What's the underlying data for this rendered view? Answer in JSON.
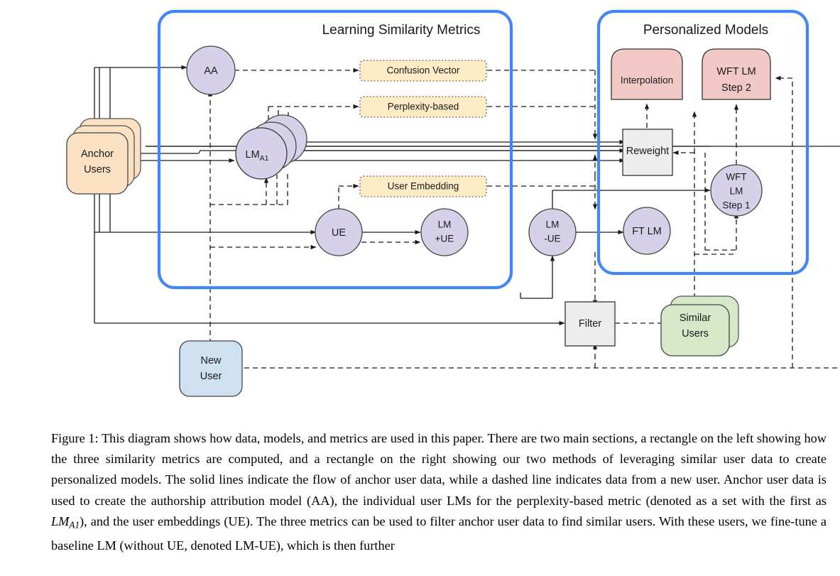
{
  "figure": {
    "sections": [
      {
        "id": "learning-similarity-metrics",
        "title": "Learning Similarity Metrics"
      },
      {
        "id": "personalized-models",
        "title": "Personalized Models"
      }
    ],
    "nodes": {
      "anchor_users": {
        "label_line1": "Anchor",
        "label_line2": "Users",
        "shape": "stacked-rounded-box",
        "fill": "#fae1c3"
      },
      "new_user": {
        "label_line1": "New",
        "label_line2": "User",
        "shape": "rounded-box",
        "fill": "#cfe0f0"
      },
      "similar_users": {
        "label_line1": "Similar",
        "label_line2": "Users",
        "shape": "stacked-rounded-box",
        "fill": "#d6e8c8"
      },
      "aa": {
        "label": "AA",
        "shape": "circle",
        "fill": "#d6d0e8"
      },
      "lm_a1": {
        "label": "LM",
        "sublabel": "A1",
        "shape": "stacked-circle",
        "fill": "#d6d0e8"
      },
      "ue": {
        "label": "UE",
        "shape": "circle",
        "fill": "#d6d0e8"
      },
      "lm_plus_ue": {
        "label_line1": "LM",
        "label_line2": "+UE",
        "shape": "circle",
        "fill": "#d6d0e8"
      },
      "lm_minus_ue": {
        "label_line1": "LM",
        "label_line2": "-UE",
        "shape": "circle",
        "fill": "#d6d0e8"
      },
      "ft_lm": {
        "label": "FT LM",
        "shape": "circle",
        "fill": "#d6d0e8"
      },
      "wft_lm_step1": {
        "label_line1": "WFT",
        "label_line2": "LM",
        "label_line3": "Step 1",
        "shape": "circle",
        "fill": "#d6d0e8"
      },
      "filter": {
        "label": "Filter",
        "shape": "square",
        "fill": "#ededed"
      },
      "reweight": {
        "label": "Reweight",
        "shape": "square",
        "fill": "#ededed"
      },
      "interpolation": {
        "label": "Interpolation",
        "shape": "tab-box",
        "fill": "#f2c9c6"
      },
      "wft_lm_step2": {
        "label_line1": "WFT LM",
        "label_line2": "Step 2",
        "shape": "tab-box",
        "fill": "#f2c9c6"
      },
      "confusion_vector": {
        "label": "Confusion Vector",
        "shape": "dotted-box",
        "fill": "#fcecc6"
      },
      "perplexity_based": {
        "label": "Perplexity-based",
        "shape": "dotted-box",
        "fill": "#fcecc6"
      },
      "user_embedding": {
        "label": "User Embedding",
        "shape": "dotted-box",
        "fill": "#fcecc6"
      }
    },
    "colors": {
      "section_border": "#4285f4",
      "purple_node": "#d6d0e8",
      "orange_node": "#fae1c3",
      "blue_node": "#cfe0f0",
      "green_node": "#d6e8c8",
      "pink_node": "#f2c9c6",
      "yellow_metric": "#fcecc6",
      "gray_node": "#ededed",
      "stroke": "#1a1a1a"
    },
    "legend": {
      "solid_line_meaning": "flow of anchor user data",
      "dashed_line_meaning": "data from a new user"
    }
  },
  "caption": {
    "label": "Figure 1:",
    "part1": " This diagram shows how data, models, and metrics are used in this paper. There are two main sections, a rectangle on the left showing how the three similarity metrics are computed, and a rectangle on the right showing our two methods of leveraging similar user data to create personalized models.  The solid lines indicate the flow of anchor user data, while a dashed line indicates data from a new user. Anchor user data is used to create the authorship attribution model (AA), the individual user LMs for the perplexity-based metric (denoted as a set with the first as ",
    "math": "LM",
    "math_sub": "A1",
    "part2": "), and the user embeddings (UE). The three metrics can be used to filter anchor user data to find similar users. With these users, we fine-tune a baseline LM (without UE, denoted LM-UE), which is then further"
  }
}
